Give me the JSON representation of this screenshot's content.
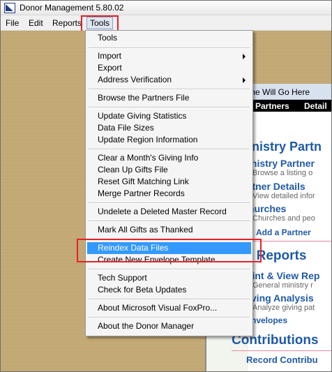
{
  "window": {
    "title": "Donor Management 5.80.02"
  },
  "menubar": {
    "items": [
      "File",
      "Edit",
      "Reports",
      "Tools"
    ]
  },
  "tools_menu": {
    "items": [
      "Tools",
      "Import",
      "Export",
      "Address Verification",
      "Browse the Partners File",
      "Update Giving Statistics",
      "Data File Sizes",
      "Update Region Information",
      "Clear a Month's Giving Info",
      "Clean Up Gifts File",
      "Reset Gift Matching Link",
      "Merge Partner Records",
      "Undelete a Deleted Master Record",
      "Mark All Gifts as Thanked",
      "Reindex Data Files",
      "Create New Envelope Template",
      "Tech Support",
      "Check for Beta Updates",
      "About Microsoft Visual FoxPro...",
      "About the Donor Manager"
    ],
    "selected": "Reindex Data Files"
  },
  "child_window": {
    "title": "me Will Go Here",
    "nav": [
      "Partners",
      "Detail"
    ],
    "h_ministry": "inistry Partn",
    "h_ministry_partner": "inistry Partner",
    "sub_browse": "Browse a listing o",
    "h_partner_details": "rtner Details",
    "sub_view": "View detailed infor",
    "h_churches": "hurches",
    "sub_churches": "Churches and peo",
    "link_add_partner": "Add a Partner",
    "h_reports": "t Reports",
    "h_print": "rint & View Rep",
    "sub_general": "General ministry r",
    "h_giving": "iving Analysis",
    "sub_analyze": "Analyze giving pat",
    "link_envelopes": "nvelopes",
    "h_contributions": "Contributions",
    "link_record_contrib": "Record Contribu"
  },
  "colors": {
    "highlight_red": "#e8202a",
    "selection_blue": "#3399ff",
    "heading_blue": "#1f5aa5",
    "desktop_tan": "#c9b07d"
  }
}
